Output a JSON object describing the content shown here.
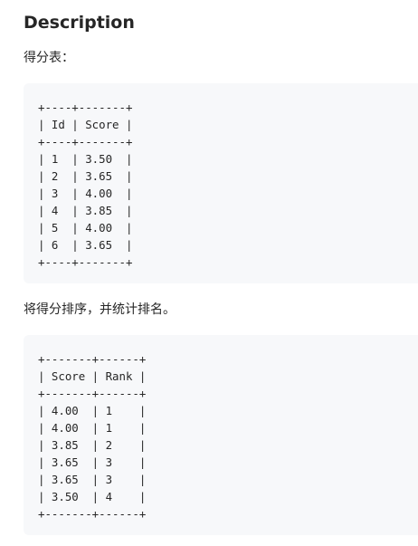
{
  "description": {
    "title": "Description",
    "intro_text": "得分表：",
    "scores_table": "+----+-------+\n| Id | Score |\n+----+-------+\n| 1  | 3.50  |\n| 2  | 3.65  |\n| 3  | 4.00  |\n| 4  | 3.85  |\n| 5  | 4.00  |\n| 6  | 3.65  |\n+----+-------+",
    "task_text": "将得分排序，并统计排名。",
    "ranks_table": "+-------+------+\n| Score | Rank |\n+-------+------+\n| 4.00  | 1    |\n| 4.00  | 1    |\n| 3.85  | 2    |\n| 3.65  | 3    |\n| 3.65  | 3    |\n| 3.50  | 4    |\n+-------+------+"
  }
}
